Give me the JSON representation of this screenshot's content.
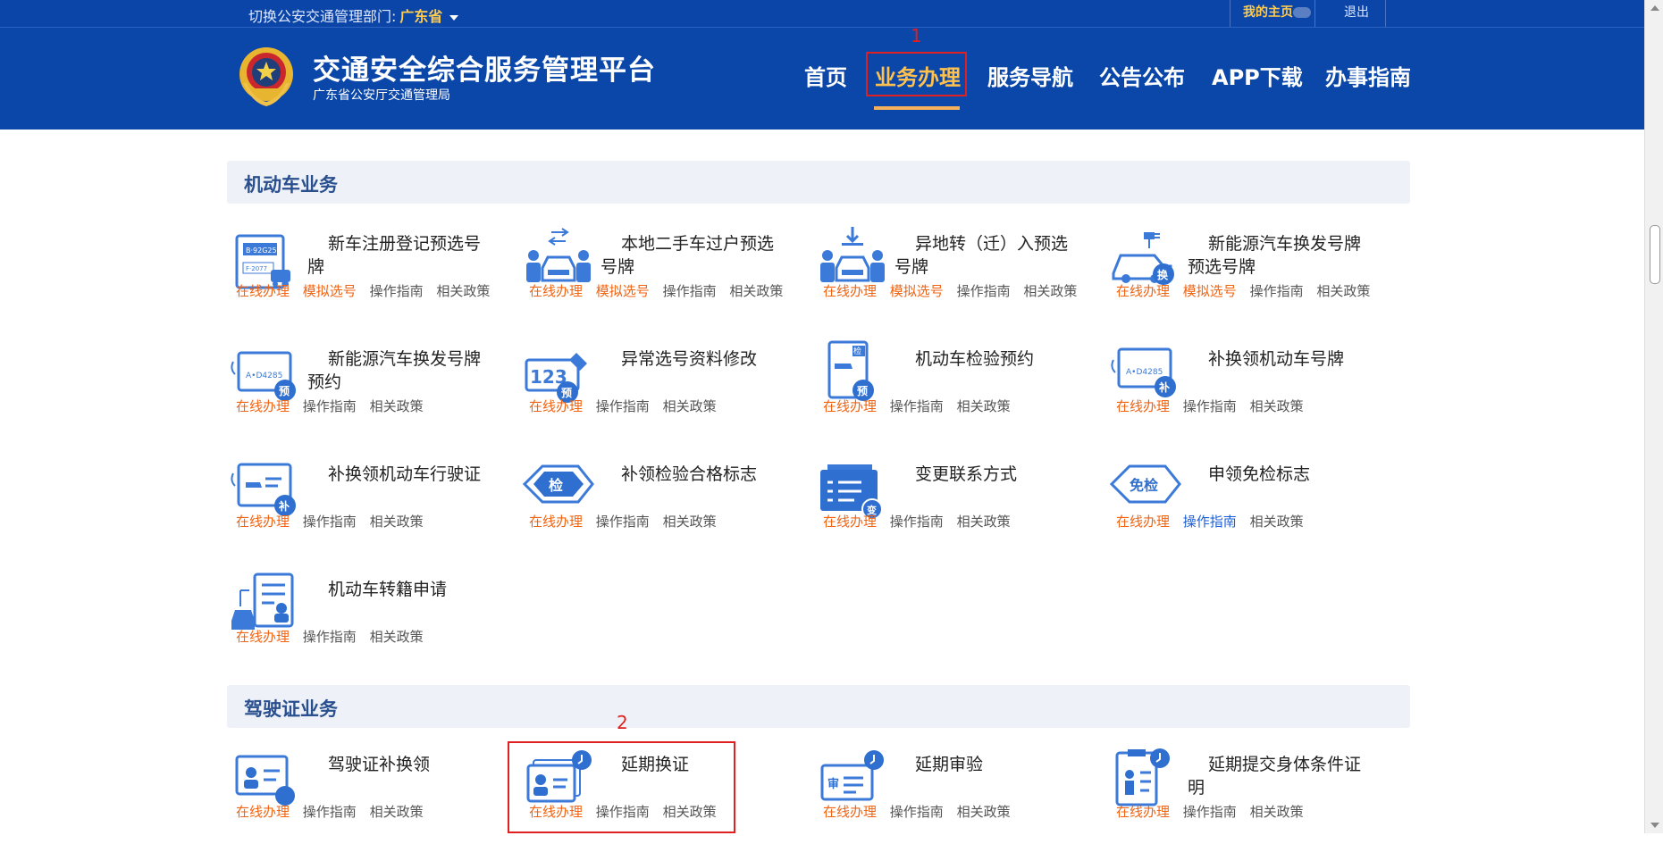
{
  "topbar": {
    "switch_label": "切换公安交通管理部门:",
    "province": "广东省",
    "my_home": "我的主页",
    "logout": "退出"
  },
  "header": {
    "title": "交通安全综合服务管理平台",
    "subtitle": "广东省公安厅交通管理局",
    "nav": [
      "首页",
      "业务办理",
      "服务导航",
      "公告公布",
      "APP下载",
      "办事指南"
    ],
    "active_nav": "业务办理",
    "marker_1": "1"
  },
  "sections": {
    "vehicle": {
      "title": "机动车业务",
      "items": [
        {
          "name": "新车注册登记预选号牌",
          "online": "在线办理",
          "mock": "模拟选号",
          "guide": "操作指南",
          "policy": "相关政策",
          "icon": "plate-car-icon"
        },
        {
          "name": "本地二手车过户预选号牌",
          "online": "在线办理",
          "mock": "模拟选号",
          "guide": "操作指南",
          "policy": "相关政策",
          "icon": "transfer-people-car-icon"
        },
        {
          "name": "异地转（迁）入预选号牌",
          "online": "在线办理",
          "mock": "模拟选号",
          "guide": "操作指南",
          "policy": "相关政策",
          "icon": "move-in-car-icon"
        },
        {
          "name": "新能源汽车换发号牌预选号牌",
          "online": "在线办理",
          "mock": "模拟选号",
          "guide": "操作指南",
          "policy": "相关政策",
          "icon": "ev-exchange-icon"
        },
        {
          "name": "新能源汽车换发号牌预约",
          "online": "在线办理",
          "guide": "操作指南",
          "policy": "相关政策",
          "icon": "plate-reserve-icon"
        },
        {
          "name": "异常选号资料修改",
          "online": "在线办理",
          "guide": "操作指南",
          "policy": "相关政策",
          "icon": "number-edit-icon"
        },
        {
          "name": "机动车检验预约",
          "online": "在线办理",
          "guide": "操作指南",
          "policy": "相关政策",
          "icon": "inspection-reserve-icon"
        },
        {
          "name": "补换领机动车号牌",
          "online": "在线办理",
          "guide": "操作指南",
          "policy": "相关政策",
          "icon": "plate-replace-icon"
        },
        {
          "name": "补换领机动车行驶证",
          "online": "在线办理",
          "guide": "操作指南",
          "policy": "相关政策",
          "icon": "license-replace-icon"
        },
        {
          "name": "补领检验合格标志",
          "online": "在线办理",
          "guide": "操作指南",
          "policy": "相关政策",
          "icon": "inspection-tag-icon"
        },
        {
          "name": "变更联系方式",
          "online": "在线办理",
          "guide": "操作指南",
          "policy": "相关政策",
          "icon": "contact-change-icon"
        },
        {
          "name": "申领免检标志",
          "online": "在线办理",
          "guide": "操作指南",
          "policy": "相关政策",
          "icon": "exempt-tag-icon"
        },
        {
          "name": "机动车转籍申请",
          "online": "在线办理",
          "guide": "操作指南",
          "policy": "相关政策",
          "icon": "transfer-register-icon"
        }
      ]
    },
    "driver": {
      "title": "驾驶证业务",
      "marker_2": "2",
      "items": [
        {
          "name": "驾驶证补换领",
          "online": "在线办理",
          "guide": "操作指南",
          "policy": "相关政策",
          "icon": "driver-card-icon"
        },
        {
          "name": "延期换证",
          "online": "在线办理",
          "guide": "操作指南",
          "policy": "相关政策",
          "icon": "extend-card-icon"
        },
        {
          "name": "延期审验",
          "online": "在线办理",
          "guide": "操作指南",
          "policy": "相关政策",
          "icon": "extend-review-icon"
        },
        {
          "name": "延期提交身体条件证明",
          "online": "在线办理",
          "guide": "操作指南",
          "policy": "相关政策",
          "icon": "health-proof-icon"
        }
      ]
    }
  },
  "colors": {
    "header_bg": "#0b46a9",
    "active_nav": "#ffc14d",
    "online_link": "#f06414",
    "highlight": "#e02020"
  }
}
